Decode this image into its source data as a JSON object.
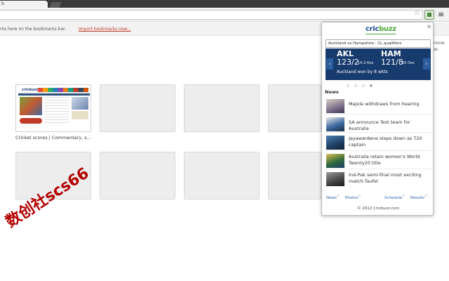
{
  "browser": {
    "tab_label": "b",
    "bookmarks_bar": {
      "text": "rks here on the bookmarks bar.",
      "import_link": "Import bookmarks now..."
    },
    "side_text": [
      "rome",
      "ar."
    ],
    "icons": [
      "star-icon",
      "cricbuzz-extension-icon",
      "menu-icon"
    ]
  },
  "thumbnails": {
    "first_caption": "Cricket scores | Commentary, s...",
    "mini_logo": "cricbuzz"
  },
  "popup": {
    "logo_left": "cric",
    "logo_right": "buzz",
    "close": "✕",
    "match_select": "Auckland vs Hampshire - CL qualifiers",
    "score": {
      "team1": "AKL",
      "team1_score": "123/2",
      "team1_overs": "14.3 Ovs",
      "team2": "HAM",
      "team2_score": "121/8",
      "team2_overs": "20 Ovs",
      "result": "Auckland won by 8 wkts",
      "prev": "‹",
      "next": "›"
    },
    "carousel": {
      "count": 4,
      "active": 3
    },
    "news_header": "News",
    "news": [
      {
        "title": "Majola withdraws from hearing",
        "thumb_color": "#8a7f9c"
      },
      {
        "title": "SA announce Test team for Australia",
        "thumb_color": "#3f6aa3"
      },
      {
        "title": "Jayawardene steps down as T20 captain",
        "thumb_color": "#2e5f8a"
      },
      {
        "title": "Australia retain women's World Twenty20 title",
        "thumb_color": "#c9a23a"
      },
      {
        "title": "Ind-Pak semi-final most exciting match:Taufel",
        "thumb_color": "#5a5a5a"
      }
    ],
    "footer_links": [
      "News",
      "Photos",
      "Schedule",
      "Results"
    ],
    "copyright": "© 2012 Cricbuzz.com"
  },
  "watermark": "数创社scs66"
}
